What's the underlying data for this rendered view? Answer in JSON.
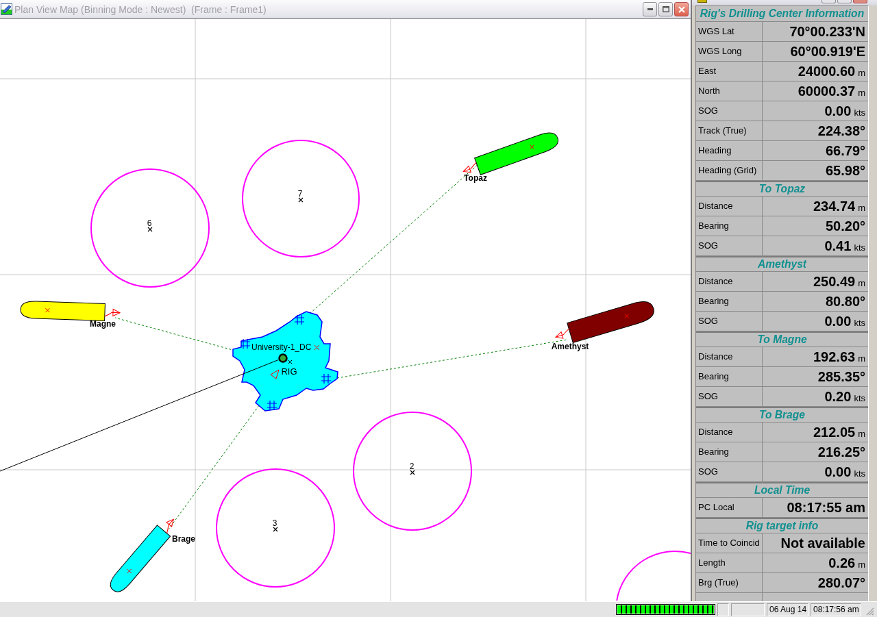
{
  "window": {
    "title": "Plan View Map (Binning Mode : Newest)  (Frame : Frame1)"
  },
  "map": {
    "circle_markers": [
      {
        "label": "6"
      },
      {
        "label": "7"
      },
      {
        "label": "2"
      },
      {
        "label": "3"
      }
    ],
    "vessels": [
      {
        "name": "Topaz",
        "color": "#00ff00"
      },
      {
        "name": "Magne",
        "color": "#ffff00"
      },
      {
        "name": "Amethyst",
        "color": "#800000"
      },
      {
        "name": "Brage",
        "color": "#00ffff"
      }
    ],
    "rig": {
      "label": "RIG",
      "structure_label": "University-1_DC"
    }
  },
  "info_panel": {
    "sections": [
      {
        "title": "Rig's Drilling Center Information",
        "rows": [
          {
            "label": "WGS Lat",
            "value": "70°00.233'N"
          },
          {
            "label": "WGS Long",
            "value": "60°00.919'E"
          },
          {
            "label": "East",
            "value": "24000.60",
            "unit": "m"
          },
          {
            "label": "North",
            "value": "60000.37",
            "unit": "m"
          },
          {
            "label": "SOG",
            "value": "0.00",
            "unit": "kts"
          },
          {
            "label": "Track (True)",
            "value": "224.38°"
          },
          {
            "label": "Heading",
            "value": "66.79°"
          },
          {
            "label": "Heading (Grid)",
            "value": "65.98°"
          }
        ]
      },
      {
        "title": "To Topaz",
        "rows": [
          {
            "label": "Distance",
            "value": "234.74",
            "unit": "m"
          },
          {
            "label": "Bearing",
            "value": "50.20°"
          },
          {
            "label": "SOG",
            "value": "0.41",
            "unit": "kts"
          }
        ]
      },
      {
        "title": "Amethyst",
        "rows": [
          {
            "label": "Distance",
            "value": "250.49",
            "unit": "m"
          },
          {
            "label": "Bearing",
            "value": "80.80°"
          },
          {
            "label": "SOG",
            "value": "0.00",
            "unit": "kts"
          }
        ]
      },
      {
        "title": "To Magne",
        "rows": [
          {
            "label": "Distance",
            "value": "192.63",
            "unit": "m"
          },
          {
            "label": "Bearing",
            "value": "285.35°"
          },
          {
            "label": "SOG",
            "value": "0.20",
            "unit": "kts"
          }
        ]
      },
      {
        "title": "To Brage",
        "rows": [
          {
            "label": "Distance",
            "value": "212.05",
            "unit": "m"
          },
          {
            "label": "Bearing",
            "value": "216.25°"
          },
          {
            "label": "SOG",
            "value": "0.00",
            "unit": "kts"
          }
        ]
      },
      {
        "title": "Local Time",
        "rows": [
          {
            "label": "PC Local",
            "value": "08:17:55 am"
          }
        ]
      },
      {
        "title": "Rig target info",
        "rows": [
          {
            "label": "Time to Coincid",
            "value": "Not available"
          },
          {
            "label": "Length",
            "value": "0.26",
            "unit": "m"
          },
          {
            "label": "Brg (True)",
            "value": "280.07°"
          }
        ]
      }
    ]
  },
  "status_bar": {
    "level": 1,
    "date": "06 Aug 14",
    "time": "08:17:56 am"
  }
}
